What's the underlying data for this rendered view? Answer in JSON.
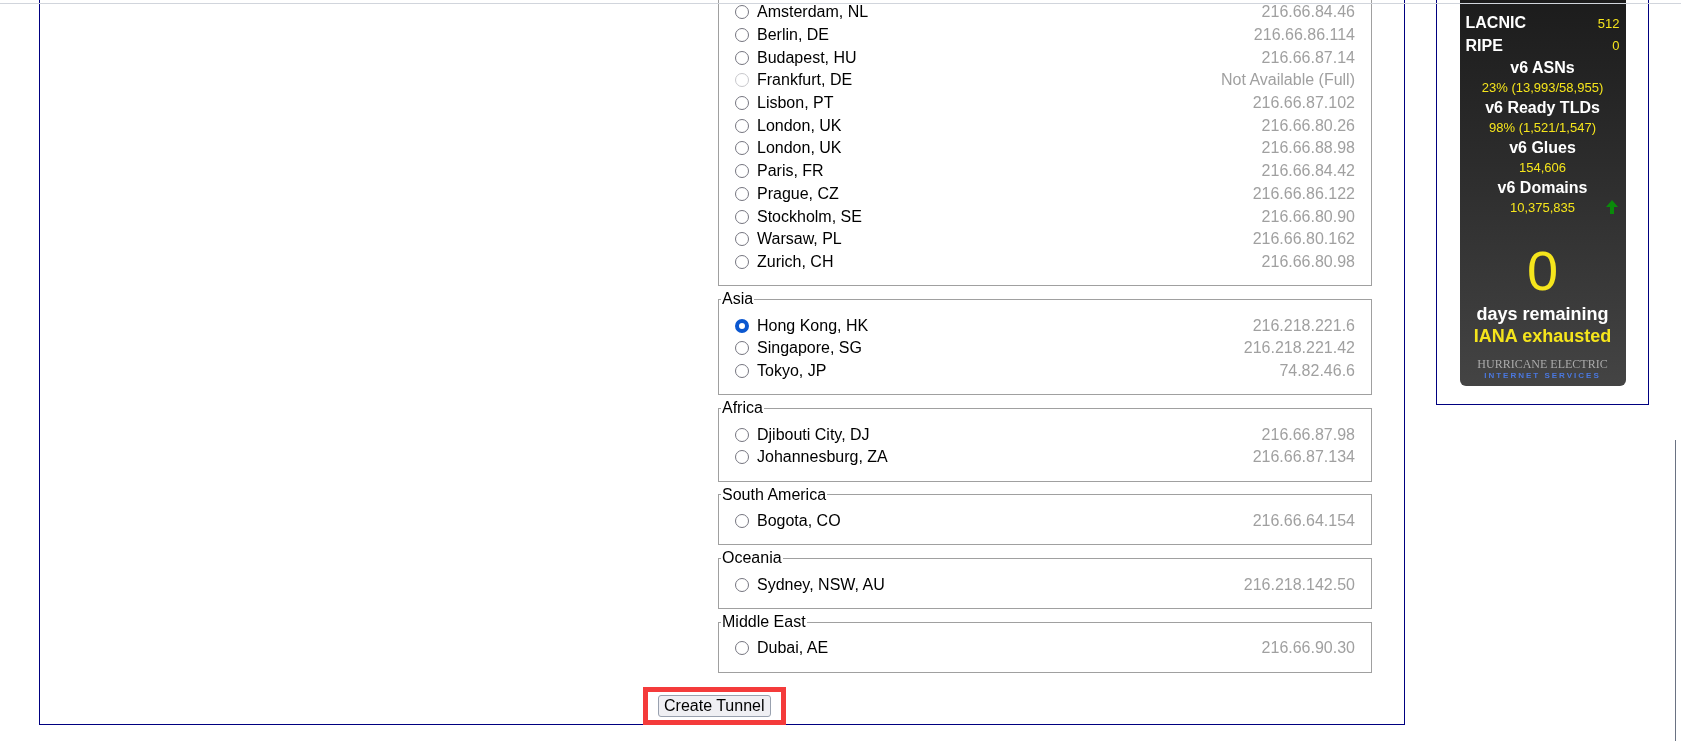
{
  "location_groups": [
    {
      "items": [
        {
          "city": "Amsterdam, NL",
          "ip": "216.66.84.46",
          "selected": false,
          "disabled": false
        },
        {
          "city": "Berlin, DE",
          "ip": "216.66.86.114",
          "selected": false,
          "disabled": false
        },
        {
          "city": "Budapest, HU",
          "ip": "216.66.87.14",
          "selected": false,
          "disabled": false
        },
        {
          "city": "Frankfurt, DE",
          "ip": "Not Available (Full)",
          "selected": false,
          "disabled": true
        },
        {
          "city": "Lisbon, PT",
          "ip": "216.66.87.102",
          "selected": false,
          "disabled": false
        },
        {
          "city": "London, UK",
          "ip": "216.66.80.26",
          "selected": false,
          "disabled": false
        },
        {
          "city": "London, UK",
          "ip": "216.66.88.98",
          "selected": false,
          "disabled": false
        },
        {
          "city": "Paris, FR",
          "ip": "216.66.84.42",
          "selected": false,
          "disabled": false
        },
        {
          "city": "Prague, CZ",
          "ip": "216.66.86.122",
          "selected": false,
          "disabled": false
        },
        {
          "city": "Stockholm, SE",
          "ip": "216.66.80.90",
          "selected": false,
          "disabled": false
        },
        {
          "city": "Warsaw, PL",
          "ip": "216.66.80.162",
          "selected": false,
          "disabled": false
        },
        {
          "city": "Zurich, CH",
          "ip": "216.66.80.98",
          "selected": false,
          "disabled": false
        }
      ]
    },
    {
      "legend": "Asia",
      "items": [
        {
          "city": "Hong Kong, HK",
          "ip": "216.218.221.6",
          "selected": true,
          "disabled": false
        },
        {
          "city": "Singapore, SG",
          "ip": "216.218.221.42",
          "selected": false,
          "disabled": false
        },
        {
          "city": "Tokyo, JP",
          "ip": "74.82.46.6",
          "selected": false,
          "disabled": false
        }
      ]
    },
    {
      "legend": "Africa",
      "items": [
        {
          "city": "Djibouti City, DJ",
          "ip": "216.66.87.98",
          "selected": false,
          "disabled": false
        },
        {
          "city": "Johannesburg, ZA",
          "ip": "216.66.87.134",
          "selected": false,
          "disabled": false
        }
      ]
    },
    {
      "legend": "South America",
      "items": [
        {
          "city": "Bogota, CO",
          "ip": "216.66.64.154",
          "selected": false,
          "disabled": false
        }
      ]
    },
    {
      "legend": "Oceania",
      "items": [
        {
          "city": "Sydney, NSW, AU",
          "ip": "216.218.142.50",
          "selected": false,
          "disabled": false
        }
      ]
    },
    {
      "legend": "Middle East",
      "items": [
        {
          "city": "Dubai, AE",
          "ip": "216.66.90.30",
          "selected": false,
          "disabled": false
        }
      ]
    }
  ],
  "submit_button": "Create Tunnel",
  "stats_widget": {
    "registries": [
      {
        "label": "LACNIC",
        "value": "512"
      },
      {
        "label": "RIPE",
        "value": "0"
      }
    ],
    "sections": [
      {
        "label": "v6 ASNs",
        "value": "23% (13,993/58,955)",
        "rising": false
      },
      {
        "label": "v6 Ready TLDs",
        "value": "98% (1,521/1,547)",
        "rising": false
      },
      {
        "label": "v6 Glues",
        "value": "154,606",
        "rising": false
      },
      {
        "label": "v6 Domains",
        "value": "10,375,835",
        "rising": true
      }
    ],
    "countdown": "0",
    "countdown_label": "days remaining",
    "status": "IANA exhausted",
    "logo_line_1": "HURRICANE ELECTRIC",
    "logo_line_2": "INTERNET SERVICES"
  }
}
